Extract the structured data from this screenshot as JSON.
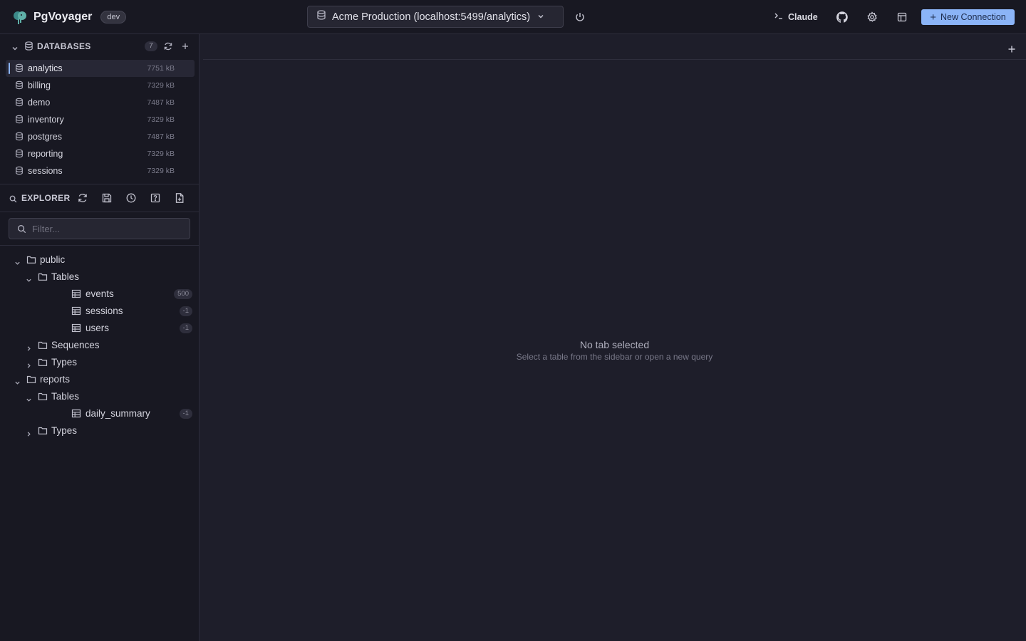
{
  "app": {
    "name": "PgVoyager",
    "env_badge": "dev"
  },
  "connection": {
    "label": "Acme Production (localhost:5499/analytics)"
  },
  "header": {
    "claude_label": "Claude",
    "new_connection_label": "New Connection"
  },
  "databases": {
    "title": "DATABASES",
    "count": "7",
    "items": [
      {
        "name": "analytics",
        "size": "7751 kB",
        "active": true
      },
      {
        "name": "billing",
        "size": "7329 kB"
      },
      {
        "name": "demo",
        "size": "7487 kB"
      },
      {
        "name": "inventory",
        "size": "7329 kB"
      },
      {
        "name": "postgres",
        "size": "7487 kB"
      },
      {
        "name": "reporting",
        "size": "7329 kB"
      },
      {
        "name": "sessions",
        "size": "7329 kB"
      }
    ]
  },
  "explorer": {
    "title": "EXPLORER",
    "filter_placeholder": "Filter...",
    "tree": [
      {
        "label": "public",
        "kind": "schema",
        "expanded": true
      },
      {
        "label": "Tables",
        "kind": "folder",
        "expanded": true
      },
      {
        "label": "events",
        "kind": "table",
        "badge": "500"
      },
      {
        "label": "sessions",
        "kind": "table",
        "badge": "-1"
      },
      {
        "label": "users",
        "kind": "table",
        "badge": "-1"
      },
      {
        "label": "Sequences",
        "kind": "folder",
        "expanded": false
      },
      {
        "label": "Types",
        "kind": "folder",
        "expanded": false
      },
      {
        "label": "reports",
        "kind": "schema",
        "expanded": true
      },
      {
        "label": "Tables",
        "kind": "folder",
        "expanded": true
      },
      {
        "label": "daily_summary",
        "kind": "table",
        "badge": "-1"
      },
      {
        "label": "Types",
        "kind": "folder",
        "expanded": false
      }
    ]
  },
  "main": {
    "empty_title": "No tab selected",
    "empty_subtitle": "Select a table from the sidebar or open a new query"
  },
  "colors": {
    "accent": "#8bb4f7",
    "background": "#1e1e2a",
    "sidebar": "#181822"
  }
}
